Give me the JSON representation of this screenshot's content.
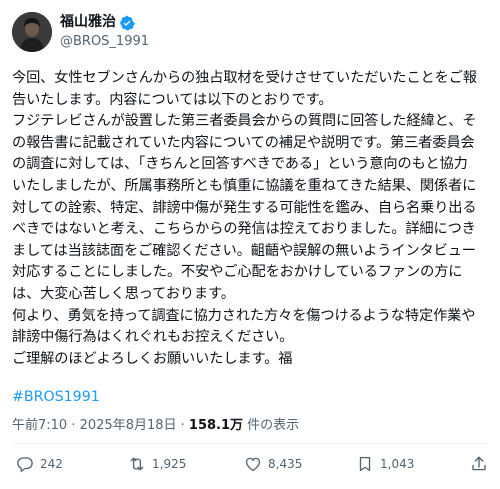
{
  "author": {
    "display_name": "福山雅治",
    "handle": "@BROS_1991",
    "verified": true,
    "avatar_icon": "avatar-photo"
  },
  "post": {
    "lines": [
      "今回、女性セブンさんからの独占取材を受けさせていただいたことをご報",
      "告いたします。内容については以下のとおりです。",
      "フジテレビさんが設置した第三者委員会からの質問に回答した経緯と、そ",
      "の報告書に記載されていた内容についての補足や説明です。第三者委員会",
      "の調査に対しては、「きちんと回答すべきである」という意向のもと協力",
      "いたしましたが、所属事務所とも慎重に協議を重ねてきた結果、関係者に",
      "対しての詮索、特定、誹謗中傷が発生する可能性を鑑み、自ら名乗り出る",
      "べきではないと考え、こちらからの発信は控えておりました。詳細につき",
      "ましては当該誌面をご確認ください。齟齬や誤解の無いようインタビュー",
      "対応することにしました。不安やご心配をおかけしているファンの方に",
      "は、大変心苦しく思っております。",
      "何より、勇気を持って調査に協力された方々を傷つけるような特定作業や",
      "誹謗中傷行為はくれぐれもお控えください。",
      "ご理解のほどよろしくお願いいたします。福"
    ],
    "hashtag": "#BROS1991"
  },
  "meta": {
    "time": "午前7:10",
    "separator": " · ",
    "date": "2025年8月18日",
    "views_count": "158.1万",
    "views_label": " 件の表示"
  },
  "actions": {
    "reply_count": "242",
    "retweet_count": "1,925",
    "like_count": "8,435",
    "views_count": "1,043"
  },
  "colors": {
    "accent": "#1d9bf0",
    "text": "#0f1419",
    "secondary": "#536471"
  }
}
